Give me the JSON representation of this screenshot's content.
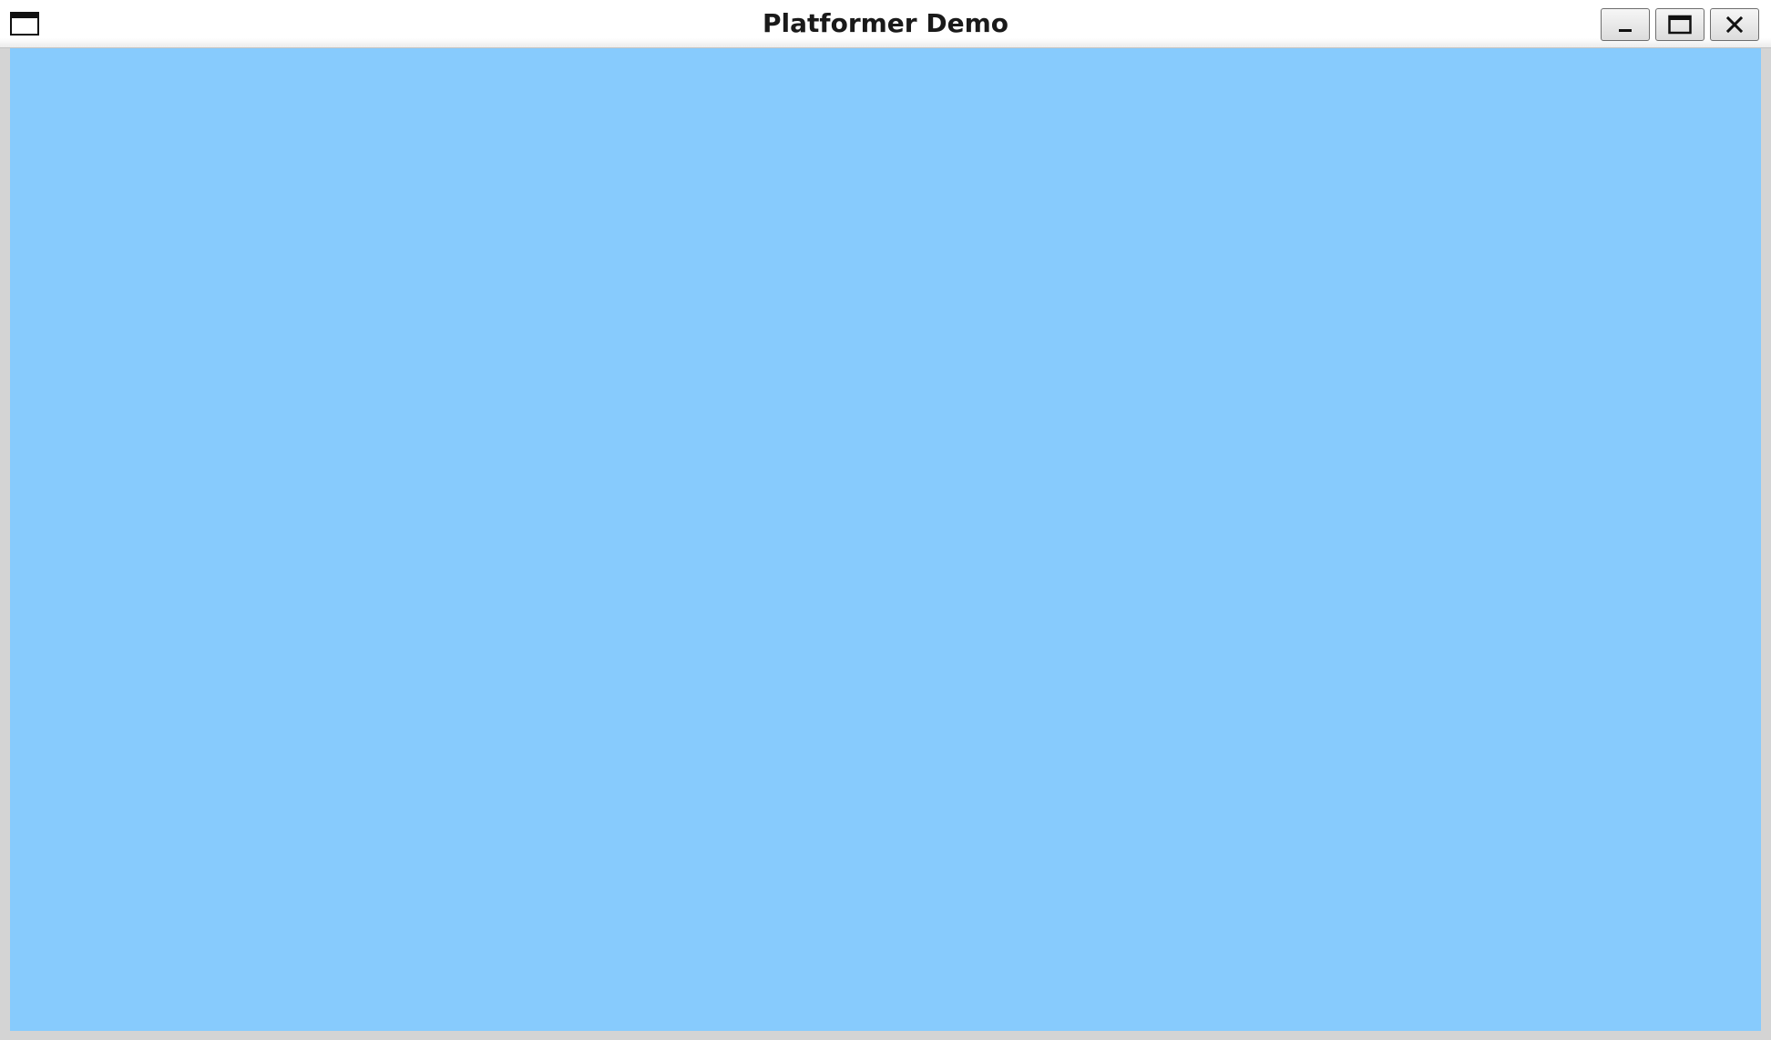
{
  "window": {
    "title": "Platformer Demo",
    "icon": "window-icon",
    "controls": {
      "minimize_icon": "minimize-icon",
      "maximize_icon": "maximize-icon",
      "close_icon": "close-icon"
    }
  },
  "game": {
    "sky_color": "#87cbfd"
  },
  "colors": {
    "titlebar": "#ffffff",
    "frame": "#d4d4d4",
    "title_text": "#1a1a1a"
  }
}
